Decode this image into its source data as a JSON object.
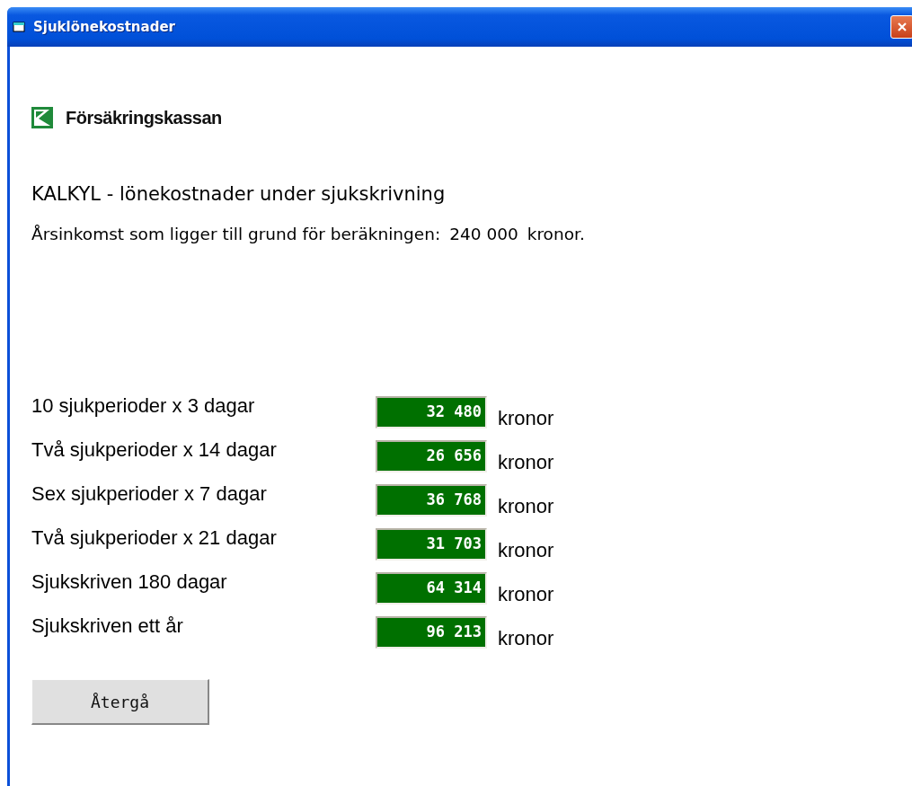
{
  "window": {
    "title": "Sjuklönekostnader"
  },
  "logo": {
    "text": "Försäkringskassan"
  },
  "heading": "KALKYL - lönekostnader under sjukskrivning",
  "income": {
    "label": "Årsinkomst som ligger till grund för beräkningen:",
    "amount": "240 000",
    "unit": "kronor."
  },
  "rows": [
    {
      "label": "10 sjukperioder x 3 dagar",
      "value": "32 480",
      "unit": "kronor"
    },
    {
      "label": "Två sjukperioder x 14 dagar",
      "value": "26 656",
      "unit": "kronor"
    },
    {
      "label": "Sex sjukperioder x 7 dagar",
      "value": "36 768",
      "unit": "kronor"
    },
    {
      "label": "Två sjukperioder x 21 dagar",
      "value": "31 703",
      "unit": "kronor"
    },
    {
      "label": "Sjukskriven 180 dagar",
      "value": "64 314",
      "unit": "kronor"
    },
    {
      "label": "Sjukskriven ett år",
      "value": "96 213",
      "unit": "kronor"
    }
  ],
  "buttons": [
    "Återgå"
  ]
}
